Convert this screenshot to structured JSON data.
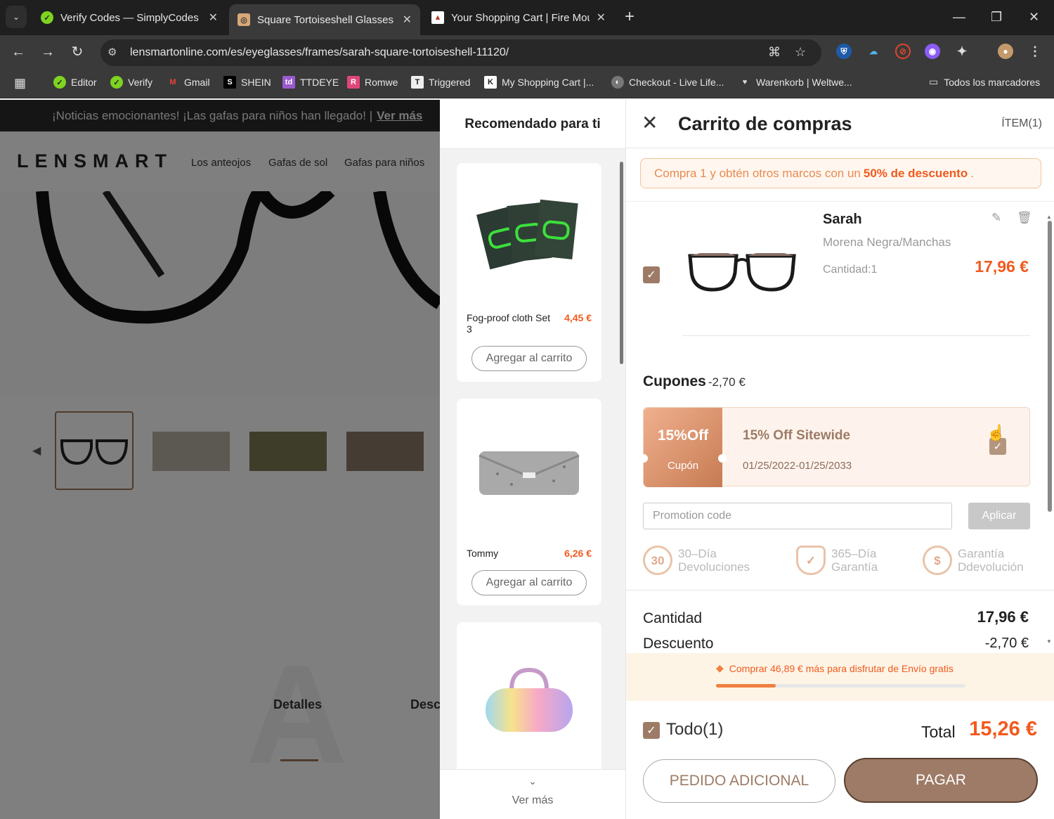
{
  "browser": {
    "tabs": [
      {
        "title": "Verify Codes — SimplyCodes",
        "favicon": "simplycodes-icon",
        "active": false
      },
      {
        "title": "Square Tortoiseshell Glasses | SI",
        "favicon": "lensmart-icon",
        "active": true
      },
      {
        "title": "Your Shopping Cart | Fire Moun",
        "favicon": "fire-mountain-icon",
        "active": false
      }
    ],
    "url": "lensmartonline.com/es/eyeglasses/frames/sarah-square-tortoiseshell-11120/",
    "bookmarks": [
      {
        "label": "Editor"
      },
      {
        "label": "Verify"
      },
      {
        "label": "Gmail"
      },
      {
        "label": "SHEIN"
      },
      {
        "label": "TTDEYE"
      },
      {
        "label": "Romwe"
      },
      {
        "label": "Triggered"
      },
      {
        "label": "My Shopping Cart |..."
      },
      {
        "label": "Checkout - Live Life..."
      },
      {
        "label": "Warenkorb | Weltwe..."
      }
    ],
    "all_bookmarks_label": "Todos los marcadores"
  },
  "site": {
    "promo_text": "¡Noticias emocionantes! ¡Las gafas para niños han llegado! |",
    "promo_link": "Ver más",
    "logo": "LENSMART",
    "nav": [
      "Los anteojos",
      "Gafas de sol",
      "Gafas para niños"
    ],
    "detail_tabs": [
      "Detalles",
      "Desc"
    ]
  },
  "recommended": {
    "title": "Recomendado para ti",
    "items": [
      {
        "name": "Fog-proof cloth Set 3",
        "price": "4,45 €",
        "button": "Agregar al carrito"
      },
      {
        "name": "Tommy",
        "price": "6,26 €",
        "button": "Agregar al carrito"
      },
      {
        "name": "",
        "price": "",
        "button": ""
      }
    ],
    "more_label": "Ver más"
  },
  "cart": {
    "title": "Carrito de compras",
    "item_count": "ÍTEM(1)",
    "offer_prefix": "Compra 1 y obtén otros marcos con un",
    "offer_highlight": "50% de descuento",
    "offer_suffix": ".",
    "item": {
      "name": "Sarah",
      "color": "Morena Negra/Manchas",
      "quantity": "Cantidad:1",
      "price": "17,96 €"
    },
    "coupons_label": "Cupones",
    "coupons_discount": "-2,70 €",
    "coupon": {
      "badge": "15%Off",
      "badge_tag": "Cupón",
      "title": "15% Off Sitewide",
      "dates": "01/25/2022-01/25/2033"
    },
    "promo_placeholder": "Promotion code",
    "apply_label": "Aplicar",
    "guarantees": [
      {
        "icon_text": "30",
        "line1": "30–Día",
        "line2": "Devoluciones"
      },
      {
        "icon_text": "✓",
        "line1": "365–Día",
        "line2": "Garantía"
      },
      {
        "icon_text": "$",
        "line1": "Garantía",
        "line2": "Ddevolución"
      }
    ],
    "summary": [
      {
        "label": "Cantidad",
        "value": "17,96 €"
      },
      {
        "label": "Descuento",
        "value": "-2,70 €"
      }
    ],
    "shipping_text": "Comprar 46,89 € más para disfrutar de Envío gratis",
    "shipping_progress": 0.24,
    "select_all_label": "Todo(1)",
    "total_label": "Total",
    "total_value": "15,26 €",
    "additional_button": "PEDIDO ADICIONAL",
    "pay_button": "PAGAR"
  },
  "colors": {
    "accent": "#9d7b66",
    "price": "#f25a1e"
  }
}
